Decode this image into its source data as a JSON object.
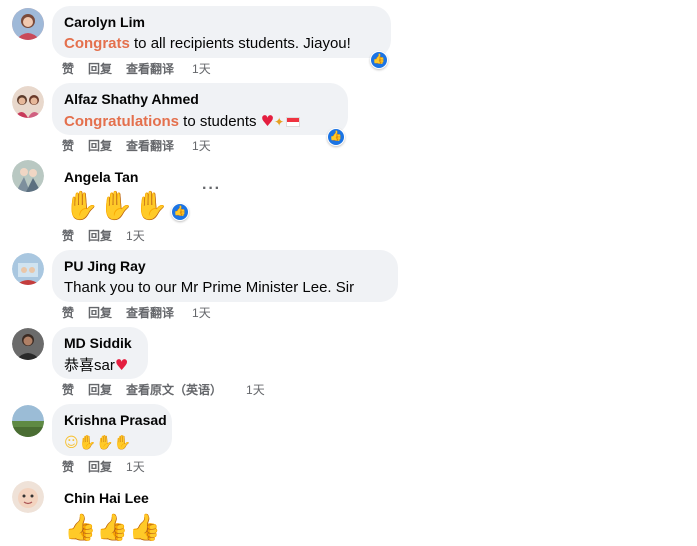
{
  "comments": [
    {
      "name": "Carolyn Lim",
      "text_highlight": "Congrats",
      "text_rest": " to all recipients students. Jiayou!",
      "actions": {
        "like": "赞",
        "reply": "回复",
        "translate": "查看翻译",
        "time": "1天"
      },
      "colors": {
        "avatar": "#c98b8b"
      }
    },
    {
      "name": "Alfaz Shathy Ahmed",
      "text_highlight": "Congratulations",
      "text_rest": " to students ",
      "emojis": [
        "red-heart",
        "party-popper",
        "singapore-flag"
      ],
      "actions": {
        "like": "赞",
        "reply": "回复",
        "translate": "查看翻译",
        "time": "1天"
      },
      "colors": {
        "avatar": "#d8b0a0"
      }
    },
    {
      "name": "Angela Tan",
      "emojis": [
        "clapping-hands",
        "clapping-hands",
        "clapping-hands"
      ],
      "actions": {
        "like": "赞",
        "reply": "回复",
        "time": "1天"
      },
      "colors": {
        "avatar": "#8aa39a"
      }
    },
    {
      "name": "PU Jing Ray",
      "text": "Thank you to our Mr Prime Minister Lee. Sir",
      "actions": {
        "like": "赞",
        "reply": "回复",
        "translate": "查看翻译",
        "time": "1天"
      },
      "colors": {
        "avatar": "#7ba5c4"
      }
    },
    {
      "name": "MD Siddik",
      "text": "恭喜sar",
      "emojis": [
        "red-heart"
      ],
      "actions": {
        "like": "赞",
        "reply": "回复",
        "translate": "查看原文（英语）",
        "time": "1天"
      },
      "colors": {
        "avatar": "#4a4a4a"
      }
    },
    {
      "name": "Krishna Prasad",
      "emojis": [
        "smiling-face",
        "clapping-hands",
        "clapping-hands",
        "clapping-hands"
      ],
      "actions": {
        "like": "赞",
        "reply": "回复",
        "time": "1天"
      },
      "colors": {
        "avatar": "#6d8f5a"
      }
    },
    {
      "name": "Chin Hai Lee",
      "emojis": [
        "thumbs-up",
        "thumbs-up",
        "thumbs-up"
      ],
      "colors": {
        "avatar": "#e8d2c4"
      }
    }
  ],
  "icons": {
    "like_badge": "like-thumb-icon",
    "more": "more-options-icon"
  },
  "colors": {
    "highlight": "#e4704d",
    "bubble": "#f0f2f5",
    "like_blue": "#1b74e4",
    "meta": "#65676b",
    "heart": "#e41e3f",
    "emoji_yellow": "#f7c235"
  }
}
